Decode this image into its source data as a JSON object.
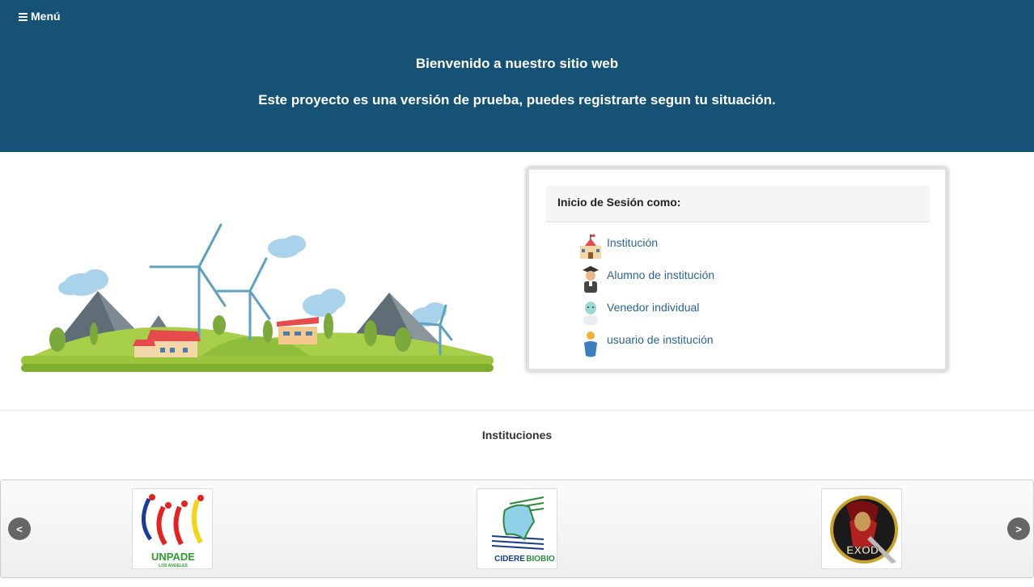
{
  "header": {
    "menu_label": "Menú",
    "title": "Bienvenido a nuestro sitio web",
    "subtitle": "Este proyecto es una versión de prueba, puedes registrarte segun tu situación."
  },
  "login": {
    "heading": "Inicio de Sesión como:",
    "options": [
      {
        "label": "Institución",
        "icon": "school-building-icon"
      },
      {
        "label": "Alumno de institución",
        "icon": "graduate-student-icon"
      },
      {
        "label": "Venedor individual",
        "icon": "vendor-person-icon"
      },
      {
        "label": "usuario de institución",
        "icon": "user-icon"
      }
    ]
  },
  "institutions": {
    "title": "Instituciones",
    "prev_label": "<",
    "next_label": ">",
    "logos": [
      {
        "name": "unpade-logo",
        "text": "UNPADE",
        "subtext": "LOS ANGELES"
      },
      {
        "name": "cidere-biobio-logo",
        "text_a": "CIDERE",
        "text_b": "BIOBIO"
      },
      {
        "name": "exod-logo",
        "text": "EXOD"
      }
    ]
  },
  "colors": {
    "header_bg": "#155275",
    "link": "#2a6496",
    "grass": "#9bc53d"
  }
}
